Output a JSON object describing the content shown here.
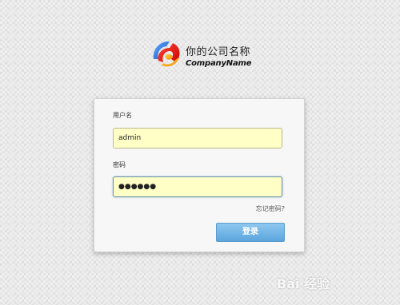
{
  "brand": {
    "name_cn": "你的公司名称",
    "name_en": "CompanyName",
    "logo_icon": "sphere-logo-icon"
  },
  "login": {
    "username_label": "用户名",
    "username_value": "admin",
    "password_label": "密码",
    "password_value": "●●●●●●",
    "forgot_link": "忘记密码?",
    "submit_label": "登录"
  },
  "watermark": {
    "text": "Bai 经验"
  },
  "colors": {
    "field_bg": "#ffffc6",
    "button_blue": "#5ba5de"
  }
}
